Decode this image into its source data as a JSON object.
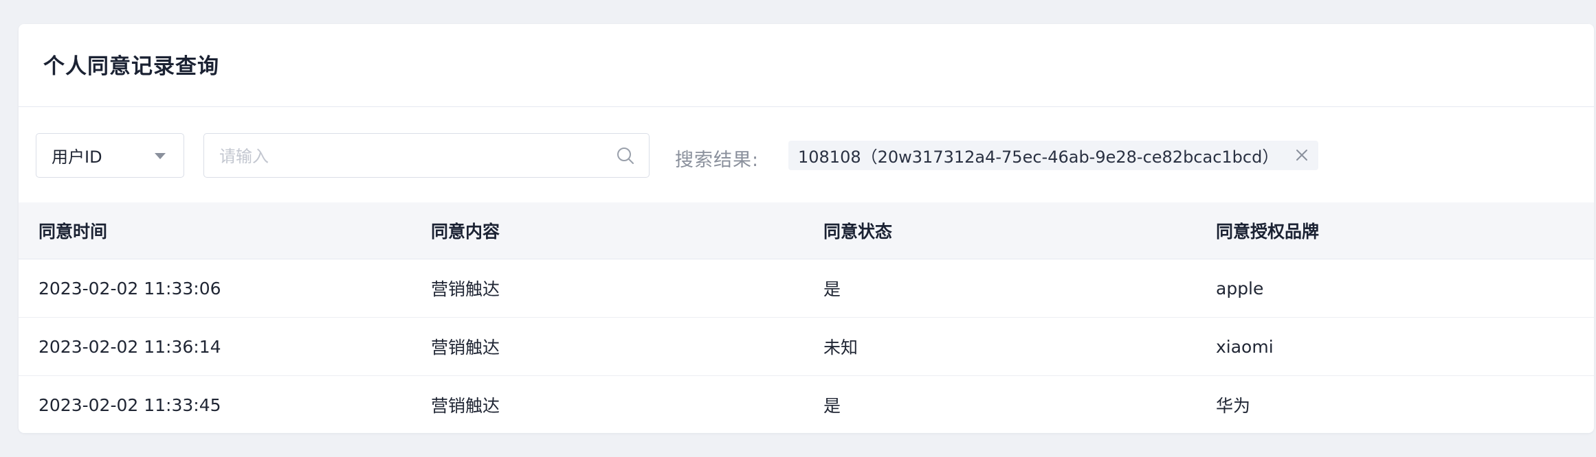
{
  "page": {
    "title": "个人同意记录查询"
  },
  "filter": {
    "field_selected": "用户ID",
    "search_placeholder": "请输入",
    "result_label": "搜索结果:",
    "result_value": "108108（20w317312a4-75ec-46ab-9e28-ce82bcac1bcd）"
  },
  "table": {
    "headers": [
      "同意时间",
      "同意内容",
      "同意状态",
      "同意授权品牌"
    ],
    "rows": [
      [
        "2023-02-02 11:33:06",
        "营销触达",
        "是",
        "apple"
      ],
      [
        "2023-02-02 11:36:14",
        "营销触达",
        "未知",
        "xiaomi"
      ],
      [
        "2023-02-02 11:33:45",
        "营销触达",
        "是",
        "华为"
      ]
    ]
  },
  "icons": {
    "dropdown": "caret-down-icon",
    "search": "search-icon",
    "clear": "close-icon"
  },
  "colors": {
    "page_background": "#eff1f5",
    "card_background": "#ffffff",
    "table_header_background": "#f5f6f9",
    "tag_background": "#f2f4f8",
    "muted_text": "#8a909c",
    "primary_text": "#1f2533"
  }
}
